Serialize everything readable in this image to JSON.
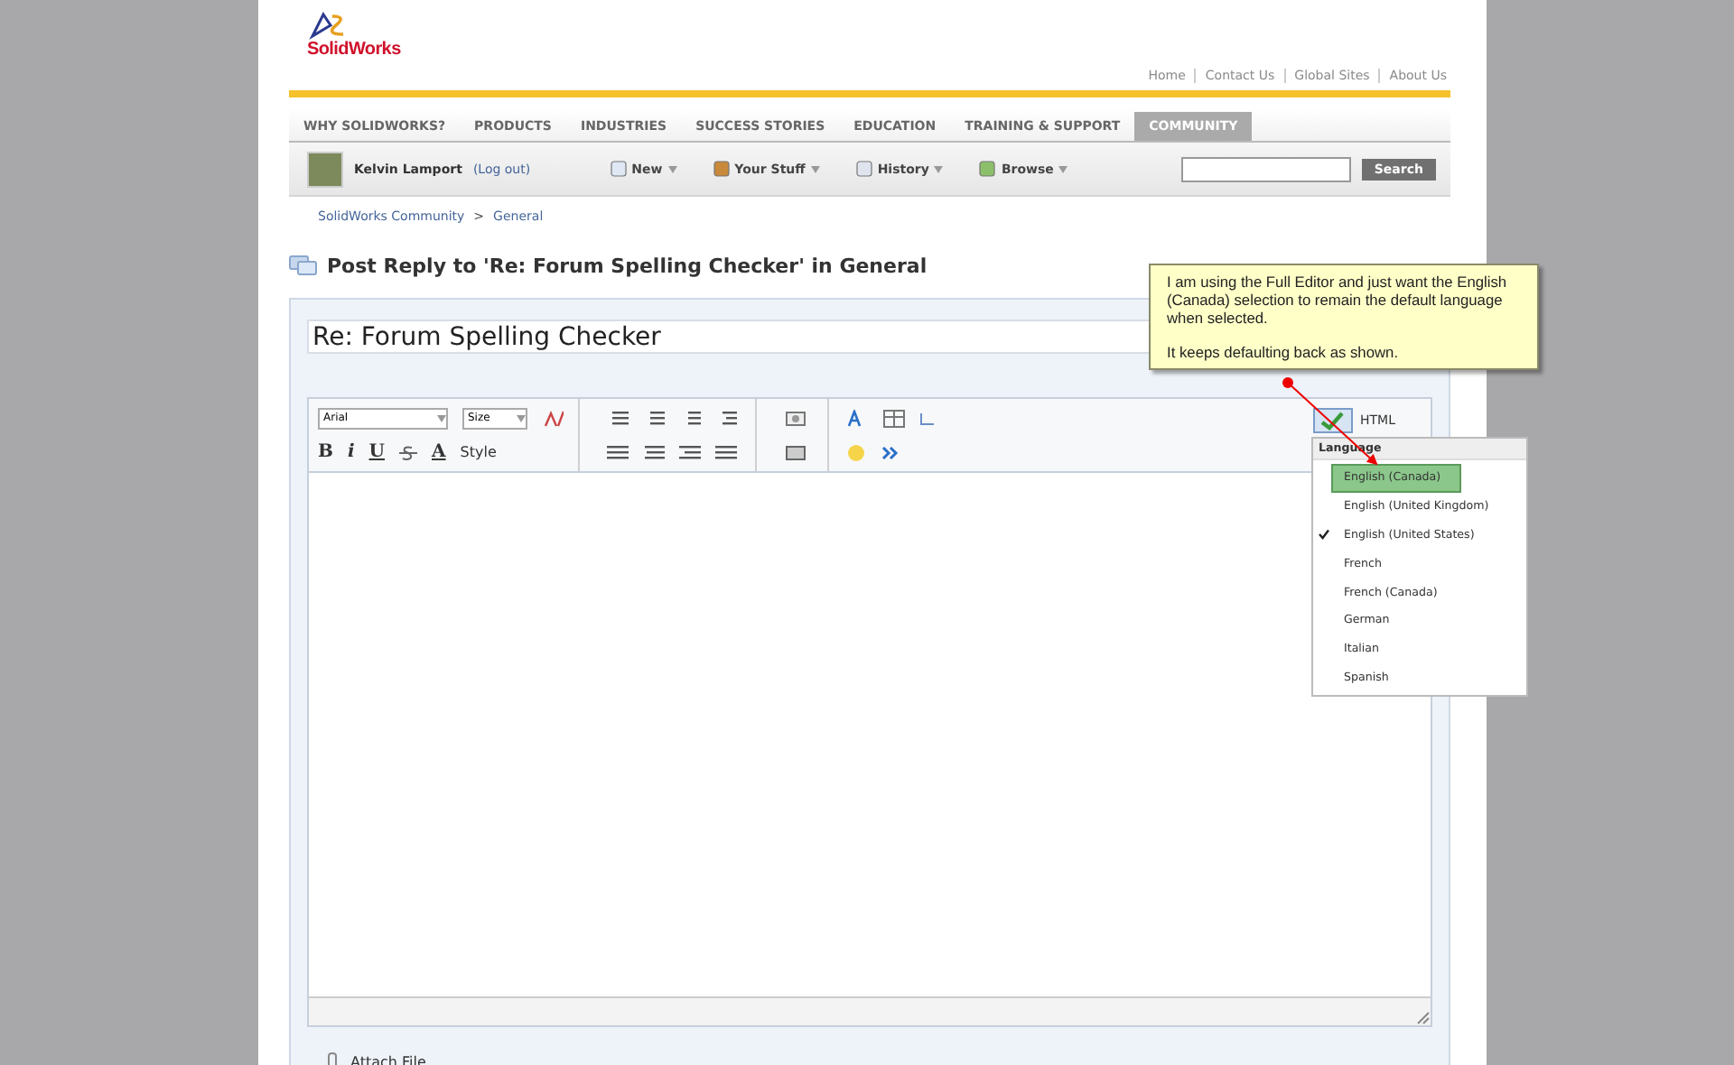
{
  "logo": {
    "text": "SolidWorks"
  },
  "top_links": [
    "Home",
    "Contact Us",
    "Global Sites",
    "About Us"
  ],
  "nav_tabs": [
    {
      "label": "WHY SOLIDWORKS?",
      "selected": false
    },
    {
      "label": "PRODUCTS",
      "selected": false
    },
    {
      "label": "INDUSTRIES",
      "selected": false
    },
    {
      "label": "SUCCESS STORIES",
      "selected": false
    },
    {
      "label": "EDUCATION",
      "selected": false
    },
    {
      "label": "TRAINING & SUPPORT",
      "selected": false
    },
    {
      "label": "COMMUNITY",
      "selected": true
    }
  ],
  "user_bar": {
    "user": "Kelvin Lamport",
    "logout": "(Log out)",
    "menus": [
      "New",
      "Your Stuff",
      "History",
      "Browse"
    ],
    "search_button": "Search"
  },
  "breadcrumb": [
    "SolidWorks Community",
    "General"
  ],
  "breadcrumb_separator": ">",
  "heading": "Post Reply to 'Re: Forum Spelling Checker' in General",
  "subject": "Re: Forum Spelling Checker",
  "toolbar": {
    "font": "Arial",
    "size": "Size",
    "format_letters": [
      "B",
      "i",
      "U"
    ],
    "color_letter": "A",
    "style": "Style",
    "html": "HTML"
  },
  "language_menu": {
    "title": "Language",
    "items": [
      {
        "label": "English (Canada)",
        "selected": true,
        "checked": false
      },
      {
        "label": "English (United Kingdom)",
        "selected": false,
        "checked": false
      },
      {
        "label": "English (United States)",
        "selected": false,
        "checked": true
      },
      {
        "label": "French",
        "selected": false,
        "checked": false
      },
      {
        "label": "French (Canada)",
        "selected": false,
        "checked": false
      },
      {
        "label": "German",
        "selected": false,
        "checked": false
      },
      {
        "label": "Italian",
        "selected": false,
        "checked": false
      },
      {
        "label": "Spanish",
        "selected": false,
        "checked": false
      }
    ]
  },
  "callout": {
    "paragraphs": [
      "I am using the Full Editor and just want the English (Canada) selection to remain the default language when selected.",
      "It keeps defaulting back as shown."
    ]
  },
  "attach": "Attach File"
}
